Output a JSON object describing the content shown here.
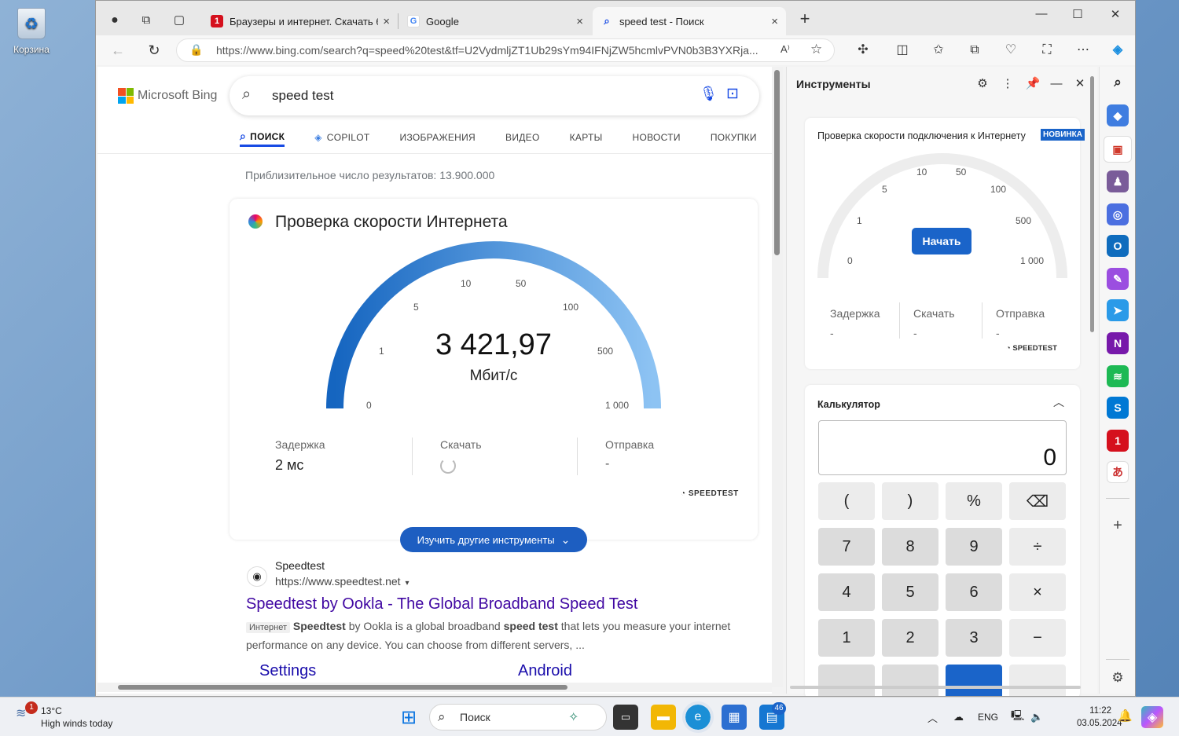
{
  "desktop": {
    "recycle_bin_label": "Корзина"
  },
  "tabs": [
    {
      "title": "Браузеры и интернет. Скачать б",
      "close": "×"
    },
    {
      "title": "Google",
      "close": "×"
    },
    {
      "title": "speed test - Поиск",
      "close": "×"
    }
  ],
  "tabbar": {
    "new_tab": "+"
  },
  "window_controls": {
    "minimize": "—",
    "maximize": "☐",
    "close": "✕"
  },
  "address": {
    "url": "https://www.bing.com/search?q=speed%20test&tf=U2VydmljZT1Ub29sYm94IFNjZW5hcmlvPVN0b3B3YXRja..."
  },
  "bing": {
    "logo_text": "Microsoft Bing",
    "query": "speed test",
    "scopes": [
      "ПОИСК",
      "COPILOT",
      "ИЗОБРАЖЕНИЯ",
      "ВИДЕО",
      "КАРТЫ",
      "НОВОСТИ",
      "ПОКУПКИ"
    ],
    "result_count": "Приблизительное число результатов: 13.900.000"
  },
  "speedtest": {
    "title": "Проверка скорости Интернета",
    "value": "3 421,97",
    "unit": "Мбит/с",
    "scale": [
      "0",
      "1",
      "5",
      "10",
      "50",
      "100",
      "500",
      "1 000"
    ],
    "latency_label": "Задержка",
    "latency_value": "2 мс",
    "download_label": "Скачать",
    "upload_label": "Отправка",
    "upload_value": "-",
    "provider": "SPEEDTEST",
    "explore_button": "Изучить другие инструменты"
  },
  "result": {
    "site": "Speedtest",
    "url": "https://www.speedtest.net",
    "title": "Speedtest by Ookla - The Global Broadband Speed Test",
    "tag": "Интернет",
    "snippet_b1": "Speedtest",
    "snippet_t1": " by Ookla is a global broadband ",
    "snippet_b2": "speed test",
    "snippet_t2": " that lets you measure your internet performance on any device. You can choose from different servers, ...",
    "sublinks": [
      "Settings",
      "Android"
    ]
  },
  "side_panel": {
    "title": "Инструменты",
    "speed_title": "Проверка скорости подключения к Интернету",
    "badge": "НОВИНКА",
    "start_button": "Начать",
    "scale": [
      "0",
      "1",
      "5",
      "10",
      "50",
      "100",
      "500",
      "1 000"
    ],
    "latency_label": "Задержка",
    "download_label": "Скачать",
    "upload_label": "Отправка",
    "dash": "-",
    "provider": "SPEEDTEST",
    "calc_title": "Калькулятор",
    "calc_display": "0",
    "calc_keys": [
      "(",
      ")",
      "%",
      "⌫",
      "7",
      "8",
      "9",
      "÷",
      "4",
      "5",
      "6",
      "×",
      "1",
      "2",
      "3",
      "−"
    ]
  },
  "taskbar": {
    "weather_temp": "13°C",
    "weather_desc": "High winds today",
    "weather_badge": "1",
    "search_label": "Поиск",
    "store_badge": "46",
    "lang": "ENG",
    "time": "11:22",
    "date": "03.05.2024"
  },
  "colors": {
    "bing_blue": "#174ae4",
    "accent": "#1a64c9",
    "gauge_start": "#1565c0",
    "gauge_end": "#8dc3f3",
    "link_purple": "#4007a2"
  }
}
